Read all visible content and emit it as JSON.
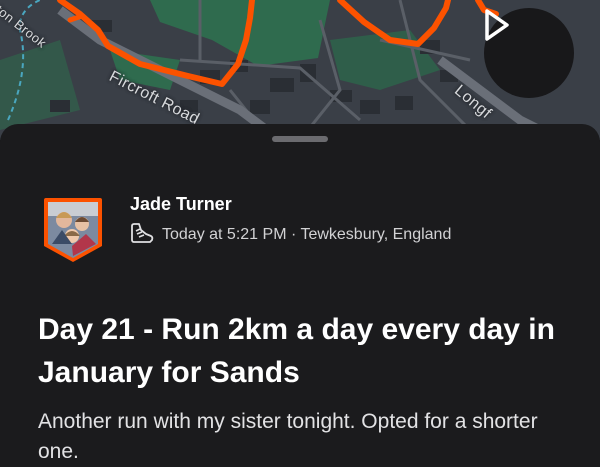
{
  "map": {
    "roads": {
      "fircroft": "Fircroft Road",
      "brook": "ton Brook",
      "longford": "Longf"
    },
    "route_color": "#fc5200",
    "play_icon": "play-icon"
  },
  "activity": {
    "athlete_name": "Jade Turner",
    "sport_icon": "running-shoe-icon",
    "meta": "Today at 5:21 PM · Tewkesbury, England",
    "title": "Day 21 - Run 2km a day every day in January for Sands",
    "description": "Another run with my sister tonight. Opted for a shorter one."
  },
  "colors": {
    "background": "#1b1b1d",
    "accent": "#fc5200"
  }
}
